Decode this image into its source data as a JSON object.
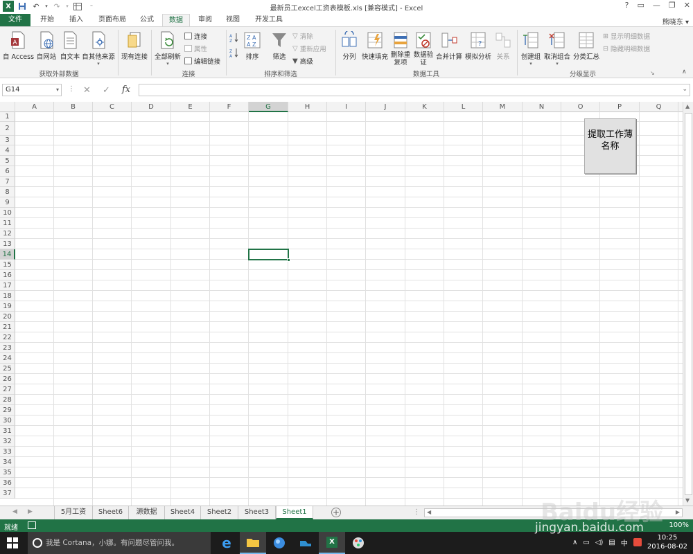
{
  "window": {
    "title": "最新员工excel工资表模板.xls  [兼容模式] - Excel",
    "controls": [
      "?",
      "▭",
      "—",
      "❐",
      "✕"
    ]
  },
  "qat": {
    "logo": "X"
  },
  "tabs": [
    {
      "label": "文件"
    },
    {
      "label": "开始"
    },
    {
      "label": "插入"
    },
    {
      "label": "页面布局"
    },
    {
      "label": "公式"
    },
    {
      "label": "数据"
    },
    {
      "label": "审阅"
    },
    {
      "label": "视图"
    },
    {
      "label": "开发工具"
    }
  ],
  "user": "熊晓东 ▾",
  "ribbon": {
    "groups": {
      "get_external": "获取外部数据",
      "connections": "连接",
      "sort_filter": "排序和筛选",
      "data_tools": "数据工具",
      "outline": "分级显示"
    },
    "buttons": {
      "access": "自 Access",
      "web": "自网站",
      "text": "自文本",
      "other": "自其他来源",
      "existing": "现有连接",
      "refresh_all": "全部刷新",
      "connections": "连接",
      "properties": "属性",
      "edit_links": "编辑链接",
      "sort": "排序",
      "filter": "筛选",
      "clear": "清除",
      "reapply": "重新应用",
      "advanced": "高级",
      "text_to_columns": "分列",
      "flash_fill": "快速填充",
      "remove_dup": "删除重复项",
      "validation": "数据验证",
      "consolidate": "合并计算",
      "whatif": "模拟分析",
      "relationships": "关系",
      "group": "创建组",
      "ungroup": "取消组合",
      "subtotal": "分类汇总",
      "show_detail": "显示明细数据",
      "hide_detail": "隐藏明细数据"
    }
  },
  "formula_bar": {
    "name_box": "G14",
    "fx": "fx",
    "value": ""
  },
  "grid": {
    "columns": [
      "A",
      "B",
      "C",
      "D",
      "E",
      "F",
      "G",
      "H",
      "I",
      "J",
      "K",
      "L",
      "M",
      "N",
      "O",
      "P",
      "Q"
    ],
    "rows": [
      "1",
      "2",
      "3",
      "4",
      "5",
      "6",
      "7",
      "8",
      "9",
      "10",
      "11",
      "12",
      "13",
      "14",
      "15",
      "16",
      "17",
      "18",
      "19",
      "20",
      "21",
      "22",
      "23",
      "24",
      "25",
      "26",
      "27",
      "28",
      "29",
      "30",
      "31",
      "32",
      "33",
      "34",
      "35",
      "36",
      "37"
    ],
    "selected_cell": "G14"
  },
  "macro_button": {
    "line1": "提取工作薄",
    "line2": "名称"
  },
  "sheets": [
    {
      "label": "5月工资"
    },
    {
      "label": "Sheet6"
    },
    {
      "label": "源数据"
    },
    {
      "label": "Sheet4"
    },
    {
      "label": "Sheet2"
    },
    {
      "label": "Sheet3"
    },
    {
      "label": "Sheet1"
    }
  ],
  "active_sheet": "Sheet1",
  "status": {
    "ready": "就绪",
    "zoom": "100%"
  },
  "taskbar": {
    "cortana": "我是 Cortana，小娜。有问题尽管问我。",
    "ime": "中",
    "time": "10:25",
    "date": "2016-08-02"
  },
  "watermark": {
    "brand": "Baidu经验",
    "url": "jingyan.baidu.com"
  },
  "colors": {
    "excel_green": "#217346",
    "taskbar": "#1c1c1c",
    "accent_blue": "#76b9ed"
  }
}
